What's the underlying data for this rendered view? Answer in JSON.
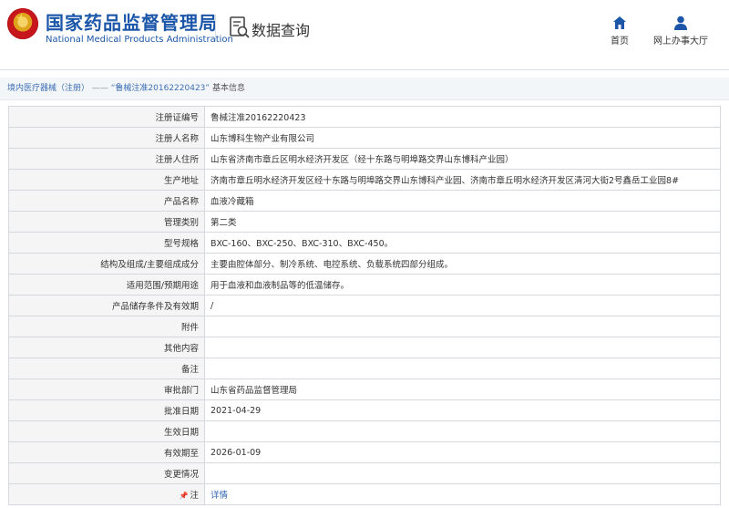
{
  "header": {
    "title_cn": "国家药品监督管理局",
    "title_en": "National Medical Products Administration",
    "query_label": "数据查询",
    "nav": [
      {
        "label": "首页",
        "icon": "home-icon"
      },
      {
        "label": "网上办事大厅",
        "icon": "user-icon"
      }
    ]
  },
  "breadcrumb": {
    "item1": "境内医疗器械（注册）",
    "separator": " —— ",
    "item2": "“鲁械注准20162220423”",
    "item3": "基本信息"
  },
  "rows": [
    {
      "label": "注册证编号",
      "value": "鲁械注准20162220423"
    },
    {
      "label": "注册人名称",
      "value": "山东博科生物产业有限公司"
    },
    {
      "label": "注册人住所",
      "value": "山东省济南市章丘区明水经济开发区（经十东路与明埠路交界山东博科产业园）"
    },
    {
      "label": "生产地址",
      "value": "济南市章丘明水经济开发区经十东路与明埠路交界山东博科产业园、济南市章丘明水经济开发区清河大街2号鑫岳工业园8#"
    },
    {
      "label": "产品名称",
      "value": "血液冷藏箱"
    },
    {
      "label": "管理类别",
      "value": "第二类"
    },
    {
      "label": "型号规格",
      "value": "BXC-160、BXC-250、BXC-310、BXC-450。"
    },
    {
      "label": "结构及组成/主要组成成分",
      "value": "主要由腔体部分、制冷系统、电控系统、负载系统四部分组成。"
    },
    {
      "label": "适用范围/预期用途",
      "value": "用于血液和血液制品等的低温储存。"
    },
    {
      "label": "产品储存条件及有效期",
      "value": "/"
    },
    {
      "label": "附件",
      "value": ""
    },
    {
      "label": "其他内容",
      "value": ""
    },
    {
      "label": "备注",
      "value": ""
    },
    {
      "label": "审批部门",
      "value": "山东省药品监督管理局"
    },
    {
      "label": "批准日期",
      "value": "2021-04-29"
    },
    {
      "label": "生效日期",
      "value": ""
    },
    {
      "label": "有效期至",
      "value": "2026-01-09"
    },
    {
      "label": "变更情况",
      "value": ""
    },
    {
      "label": "注",
      "value": "详情",
      "icon": "pin-icon"
    }
  ],
  "colors": {
    "brand_blue": "#1b56a8",
    "emblem_red": "#c8161d",
    "link": "#2f66b5"
  }
}
